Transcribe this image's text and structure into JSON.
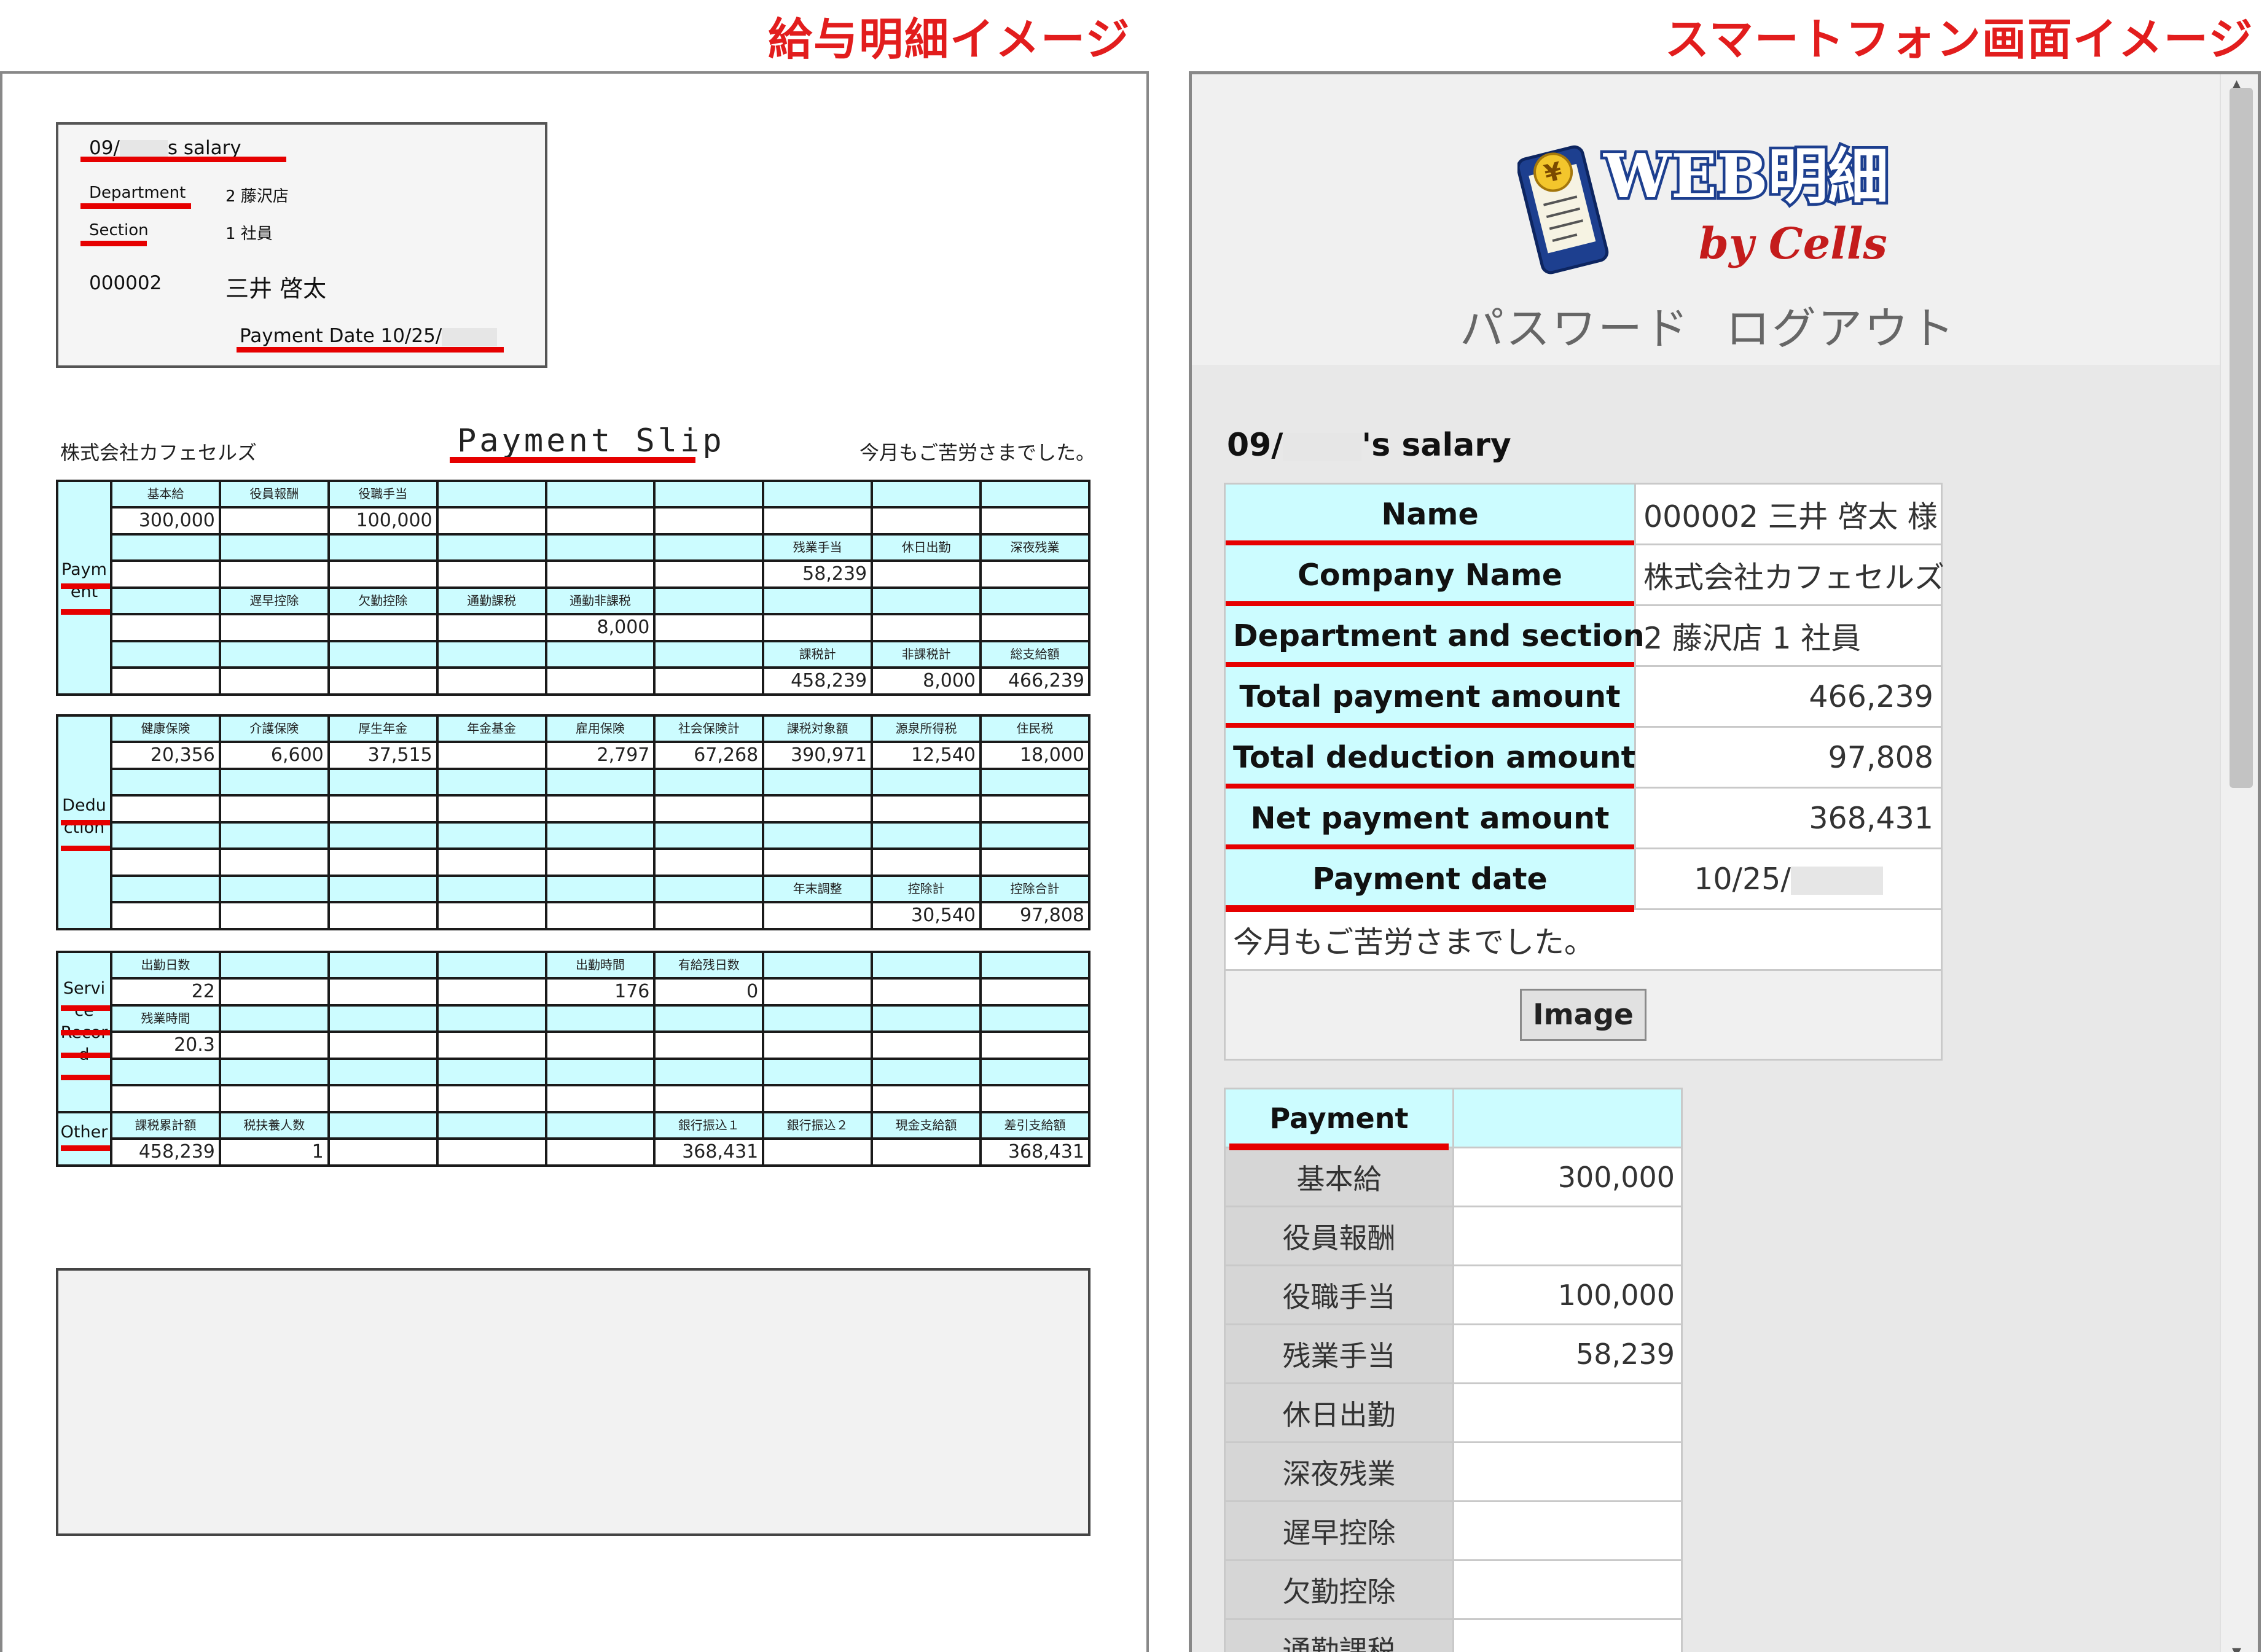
{
  "headings": {
    "left": "給与明細イメージ",
    "right": "スマートフォン画面イメージ"
  },
  "slip": {
    "box": {
      "salary_prefix": "09/",
      "salary_suffix": "s salary",
      "department_label": "Department",
      "department_value": "2 藤沢店",
      "section_label": "Section",
      "section_value": "1 社員",
      "emp_id": "000002",
      "emp_name": "三井 啓太",
      "payment_date": "Payment Date 10/25/"
    },
    "company": "株式会社カフェセルズ",
    "title": "Payment Slip",
    "closing": "今月もご苦労さまでした。",
    "payment": {
      "side": "Payment",
      "side_parts": [
        "Paym",
        "ent"
      ],
      "rows": [
        [
          "基本給",
          "役員報酬",
          "役職手当",
          "",
          "",
          "",
          "",
          "",
          ""
        ],
        [
          "300,000",
          "",
          "100,000",
          "",
          "",
          "",
          "",
          "",
          ""
        ],
        [
          "",
          "",
          "",
          "",
          "",
          "",
          "残業手当",
          "休日出勤",
          "深夜残業"
        ],
        [
          "",
          "",
          "",
          "",
          "",
          "",
          "58,239",
          "",
          ""
        ],
        [
          "",
          "遅早控除",
          "欠勤控除",
          "通勤課税",
          "通勤非課税",
          "",
          "",
          "",
          ""
        ],
        [
          "",
          "",
          "",
          "",
          "8,000",
          "",
          "",
          "",
          ""
        ],
        [
          "",
          "",
          "",
          "",
          "",
          "",
          "課税計",
          "非課税計",
          "総支給額"
        ],
        [
          "",
          "",
          "",
          "",
          "",
          "",
          "458,239",
          "8,000",
          "466,239"
        ]
      ]
    },
    "deduction": {
      "side": "Deduction",
      "side_parts": [
        "Dedu",
        "ction"
      ],
      "rows": [
        [
          "健康保険",
          "介護保険",
          "厚生年金",
          "年金基金",
          "雇用保険",
          "社会保険計",
          "課税対象額",
          "源泉所得税",
          "住民税"
        ],
        [
          "20,356",
          "6,600",
          "37,515",
          "",
          "2,797",
          "67,268",
          "390,971",
          "12,540",
          "18,000"
        ],
        [
          "",
          "",
          "",
          "",
          "",
          "",
          "",
          "",
          ""
        ],
        [
          "",
          "",
          "",
          "",
          "",
          "",
          "",
          "",
          ""
        ],
        [
          "",
          "",
          "",
          "",
          "",
          "",
          "",
          "",
          ""
        ],
        [
          "",
          "",
          "",
          "",
          "",
          "",
          "",
          "",
          ""
        ],
        [
          "",
          "",
          "",
          "",
          "",
          "",
          "年末調整",
          "控除計",
          "控除合計"
        ],
        [
          "",
          "",
          "",
          "",
          "",
          "",
          "",
          "30,540",
          "97,808"
        ]
      ]
    },
    "service": {
      "side": "Service Record",
      "side_parts": [
        "Servi",
        "ce",
        "Recor",
        "d"
      ],
      "rows": [
        [
          "出勤日数",
          "",
          "",
          "",
          "出勤時間",
          "有給残日数",
          "",
          "",
          ""
        ],
        [
          "22",
          "",
          "",
          "",
          "176",
          "0",
          "",
          "",
          ""
        ],
        [
          "残業時間",
          "",
          "",
          "",
          "",
          "",
          "",
          "",
          ""
        ],
        [
          "20.3",
          "",
          "",
          "",
          "",
          "",
          "",
          "",
          ""
        ],
        [
          "",
          "",
          "",
          "",
          "",
          "",
          "",
          "",
          ""
        ],
        [
          "",
          "",
          "",
          "",
          "",
          "",
          "",
          "",
          ""
        ]
      ]
    },
    "other": {
      "side": "Other",
      "rows": [
        [
          "課税累計額",
          "税扶養人数",
          "",
          "",
          "",
          "銀行振込１",
          "銀行振込２",
          "現金支給額",
          "差引支給額"
        ],
        [
          "458,239",
          "1",
          "",
          "",
          "",
          "368,431",
          "",
          "",
          "368,431"
        ]
      ]
    }
  },
  "phone": {
    "logo": {
      "main": "WEB明細",
      "sub": "by Cells",
      "icon": "yen-phone-icon"
    },
    "nav": {
      "password": "パスワード",
      "logout": "ログアウト"
    },
    "salary_prefix": "09/",
    "salary_suffix": "'s salary",
    "summary": [
      {
        "key": "Name",
        "value": "000002 三井 啓太 様",
        "align": "left"
      },
      {
        "key": "Company Name",
        "value": "株式会社カフェセルズ",
        "align": "left"
      },
      {
        "key": "Department and section",
        "value": "2 藤沢店 1 社員",
        "align": "left"
      },
      {
        "key": "Total payment amount",
        "value": "466,239",
        "align": "right"
      },
      {
        "key": "Total deduction amount",
        "value": "97,808",
        "align": "right"
      },
      {
        "key": "Net payment amount",
        "value": "368,431",
        "align": "right"
      },
      {
        "key": "Payment date",
        "value": "10/25/",
        "align": "center"
      }
    ],
    "message": "今月もご苦労さまでした。",
    "image_button": "Image",
    "payment_header": "Payment",
    "payment_items": [
      {
        "label": "基本給",
        "value": "300,000"
      },
      {
        "label": "役員報酬",
        "value": ""
      },
      {
        "label": "役職手当",
        "value": "100,000"
      },
      {
        "label": "残業手当",
        "value": "58,239"
      },
      {
        "label": "休日出勤",
        "value": ""
      },
      {
        "label": "深夜残業",
        "value": ""
      },
      {
        "label": "遅早控除",
        "value": ""
      },
      {
        "label": "欠勤控除",
        "value": ""
      },
      {
        "label": "通勤課税",
        "value": ""
      }
    ]
  },
  "colors": {
    "accent_red": "#e60000",
    "heading_red": "#e21d1d",
    "cyan": "#ccfcff"
  }
}
